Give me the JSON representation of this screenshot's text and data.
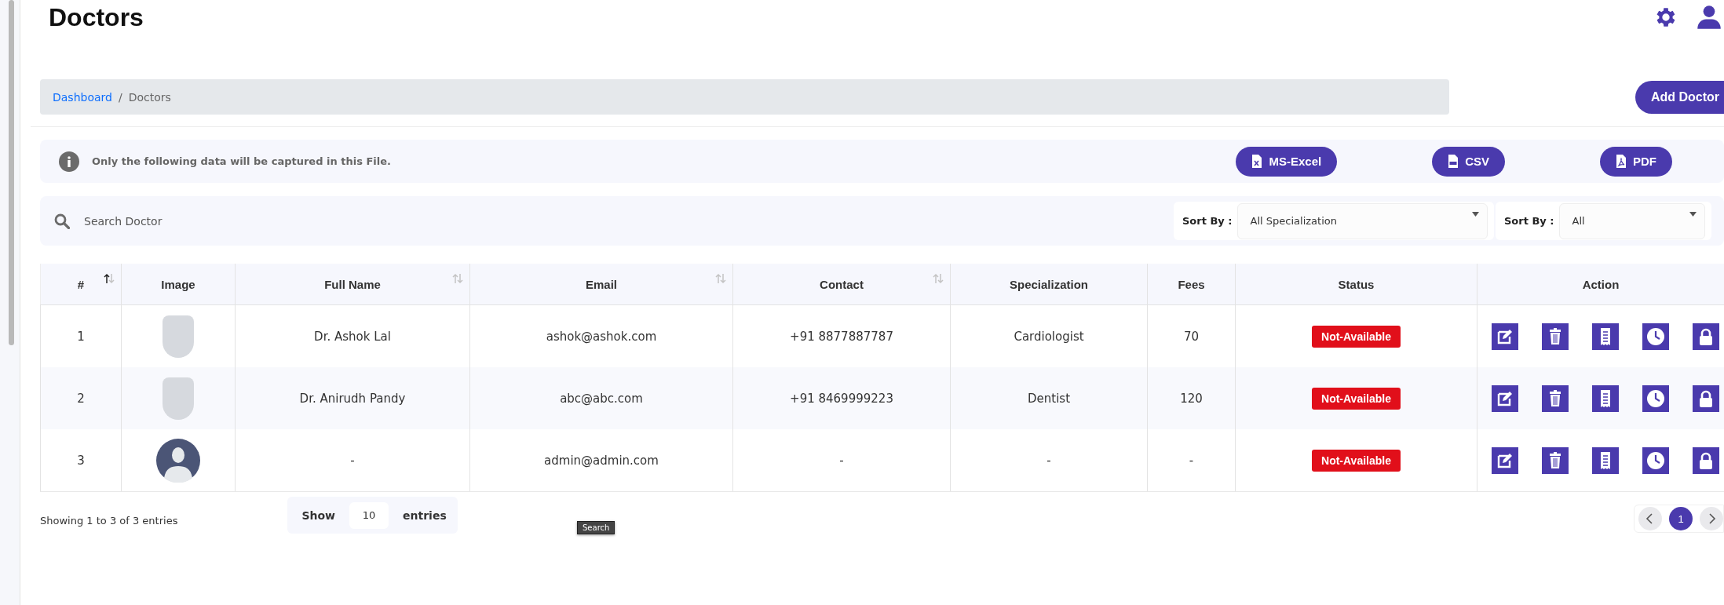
{
  "header": {
    "title": "Doctors"
  },
  "breadcrumb": {
    "separator": "/",
    "items": [
      {
        "label": "Dashboard",
        "link": true
      },
      {
        "label": "Doctors",
        "link": false
      }
    ]
  },
  "add_button": "Add Doctor",
  "export": {
    "note": "Only the following data will be captured in this File.",
    "buttons": [
      {
        "label": "MS-Excel",
        "kind": "excel"
      },
      {
        "label": "CSV",
        "kind": "csv"
      },
      {
        "label": "PDF",
        "kind": "pdf"
      }
    ]
  },
  "filters": {
    "search": {
      "placeholder": "Search Doctor"
    },
    "sorts": [
      {
        "label": "Sort By :",
        "value": "All Specialization"
      },
      {
        "label": "Sort By :",
        "value": "All"
      }
    ]
  },
  "table": {
    "columns": [
      {
        "label": "#",
        "sorted": true
      },
      {
        "label": "Image"
      },
      {
        "label": "Full Name",
        "sorted": false
      },
      {
        "label": "Email",
        "sorted": false
      },
      {
        "label": "Contact",
        "sorted": false
      },
      {
        "label": "Specialization"
      },
      {
        "label": "Fees"
      },
      {
        "label": "Status"
      },
      {
        "label": "Action"
      }
    ],
    "rows": [
      {
        "number": "1",
        "image": {
          "kind": "photo"
        },
        "full_name": "Dr. Ashok Lal",
        "email": "ashok@ashok.com",
        "contact": "+91 8877887787",
        "specialization": "Cardiologist",
        "fees": "70",
        "status": "Not-Available"
      },
      {
        "number": "2",
        "image": {
          "kind": "photo"
        },
        "full_name": "Dr. Anirudh Pandy",
        "email": "abc@abc.com",
        "contact": "+91 8469999223",
        "specialization": "Dentist",
        "fees": "120",
        "status": "Not-Available"
      },
      {
        "number": "3",
        "image": {
          "kind": "avatar"
        },
        "full_name": "-",
        "email": "admin@admin.com",
        "contact": "-",
        "specialization": "-",
        "fees": "-",
        "status": "Not-Available"
      }
    ]
  },
  "footer": {
    "info": "Showing 1 to 3 of 3 entries",
    "show_label": "Show",
    "page_size": "10",
    "entries_label": "entries",
    "pages": [
      {
        "label": "1",
        "selected": true
      }
    ]
  },
  "tooltip": "Search"
}
